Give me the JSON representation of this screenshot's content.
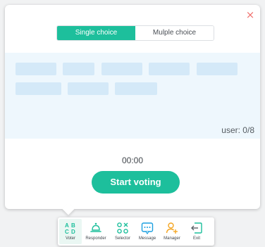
{
  "panel": {
    "close_glyph": "×",
    "mode_tabs": [
      {
        "label": "Single choice",
        "active": true
      },
      {
        "label": "Mulple choice",
        "active": false
      }
    ],
    "choices_count": 8,
    "user_count": "user: 0/8",
    "timer": "00:00",
    "start_label": "Start voting"
  },
  "toolbar": {
    "items": [
      {
        "label": "Voter",
        "icon": "abcd-icon",
        "active": true
      },
      {
        "label": "Responder",
        "icon": "bell-icon",
        "active": false
      },
      {
        "label": "Selector",
        "icon": "selector-icon",
        "active": false
      },
      {
        "label": "Message",
        "icon": "message-icon",
        "active": false
      },
      {
        "label": "Manager",
        "icon": "add-user-icon",
        "active": false
      },
      {
        "label": "Exit",
        "icon": "exit-icon",
        "active": false
      }
    ]
  },
  "colors": {
    "accent": "#1dbf9c",
    "close": "#f0726f",
    "choices_bg": "#eef7fd",
    "choice_chip": "#d4e9f8",
    "icon_tint": "#1dbf9c",
    "manager_tint": "#f4a623"
  }
}
